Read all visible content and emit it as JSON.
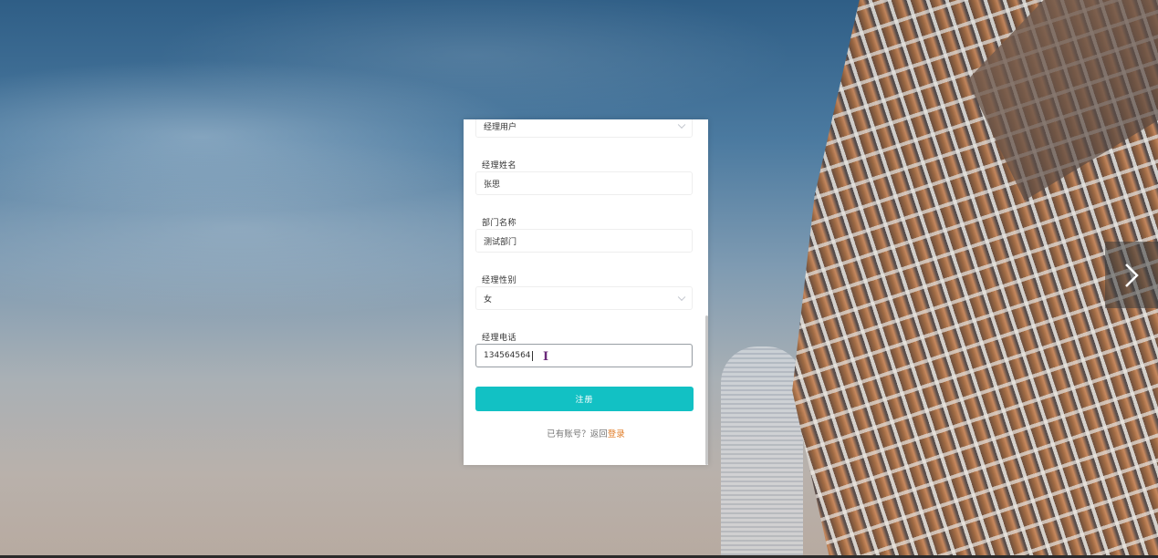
{
  "colors": {
    "accent_button": "#12c1c4",
    "link": "#e07b25",
    "card_bg": "#ffffff"
  },
  "form": {
    "user_type": {
      "value": "经理用户"
    },
    "manager_name": {
      "label": "经理姓名",
      "value": "张思"
    },
    "department": {
      "label": "部门名称",
      "value": "测试部门"
    },
    "gender": {
      "label": "经理性别",
      "value": "女"
    },
    "phone": {
      "label": "经理电话",
      "value": "134564564"
    },
    "register_label": "注册",
    "footer_prefix": "已有账号？返回",
    "footer_link": "登录"
  },
  "icons": {
    "next": "chevron-right-icon",
    "dropdown": "chevron-down-icon",
    "cursor": "text-cursor-icon"
  }
}
